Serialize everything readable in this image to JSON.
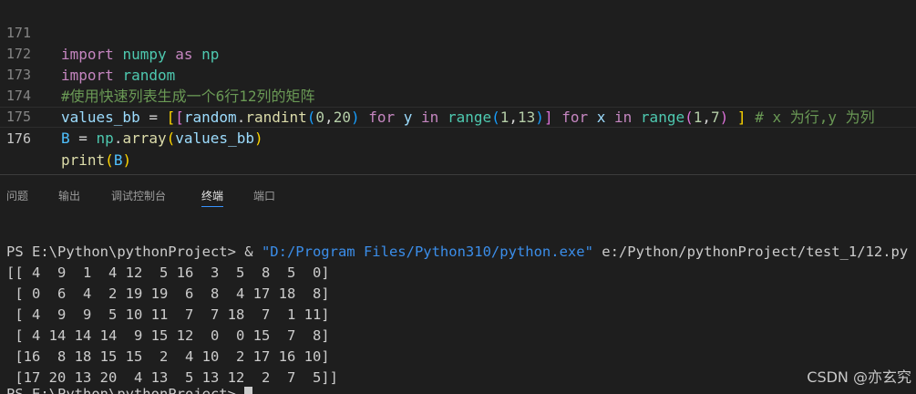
{
  "editor": {
    "lines": [
      {
        "number": "171"
      },
      {
        "number": "172"
      },
      {
        "number": "173"
      },
      {
        "number": "174"
      },
      {
        "number": "175"
      },
      {
        "number": "176"
      }
    ],
    "code": {
      "l171": {
        "import": "import",
        "module": "numpy",
        "as": "as",
        "alias": "np"
      },
      "l172": {
        "import": "import",
        "module": "random"
      },
      "l173": {
        "comment": "#使用快速列表生成一个6行12列的矩阵"
      },
      "l174": {
        "var": "values_bb",
        "eq": " = ",
        "open_outer": "[",
        "open_inner": "[",
        "obj": "random",
        "dot": ".",
        "fn": "randint",
        "paren_open": "(",
        "a0": "0",
        "comma1": ",",
        "a1": "20",
        "paren_close": ")",
        "for1": " for ",
        "y": "y",
        "in1": " in ",
        "range1": "range",
        "r1_open": "(",
        "r1_a": "1",
        "r1_comma": ",",
        "r1_b": "13",
        "r1_close": ")",
        "close_inner": "]",
        "for2": " for ",
        "x": "x",
        "in2": " in ",
        "range2": "range",
        "r2_open": "(",
        "r2_a": "1",
        "r2_comma": ",",
        "r2_b": "7",
        "r2_close": ")",
        "close_outer": " ]",
        "comment": " # x 为行,y 为列"
      },
      "l175": {
        "var": "B",
        "eq": " = ",
        "obj": "np",
        "dot": ".",
        "fn": "array",
        "open": "(",
        "arg": "values_bb",
        "close": ")"
      },
      "l176": {
        "fn": "print",
        "open": "(",
        "arg": "B",
        "close": ")"
      }
    }
  },
  "panel": {
    "tabs": [
      "问题",
      "输出",
      "调试控制台",
      "终端",
      "端口"
    ],
    "active_tab": "终端"
  },
  "terminal": {
    "command_prompt": "PS E:\\Python\\pythonProject> ",
    "command_amp": "& ",
    "command_exe": "\"D:/Program Files/Python310/python.exe\"",
    "command_script": " e:/Python/pythonProject/test_1/12.py",
    "output": [
      "[[ 4  9  1  4 12  5 16  3  5  8  5  0]",
      " [ 0  6  4  2 19 19  6  8  4 17 18  8]",
      " [ 4  9  9  5 10 11  7  7 18  7  1 11]",
      " [ 4 14 14 14  9 15 12  0  0 15  7  8]",
      " [16  8 18 15 15  2  4 10  2 17 16 10]",
      " [17 20 13 20  4 13  5 13 12  2  7  5]]"
    ],
    "final_prompt": "PS E:\\Python\\pythonProject> "
  },
  "watermark": "CSDN @亦玄究",
  "colors": {
    "background": "#1e1e1e",
    "keyword": "#c586c0",
    "variable": "#9cdcfe",
    "function": "#dcdcaa",
    "number": "#b5cea8",
    "comment": "#6a9955",
    "string": "#ce9178",
    "active_tab_underline": "#3794ff"
  }
}
